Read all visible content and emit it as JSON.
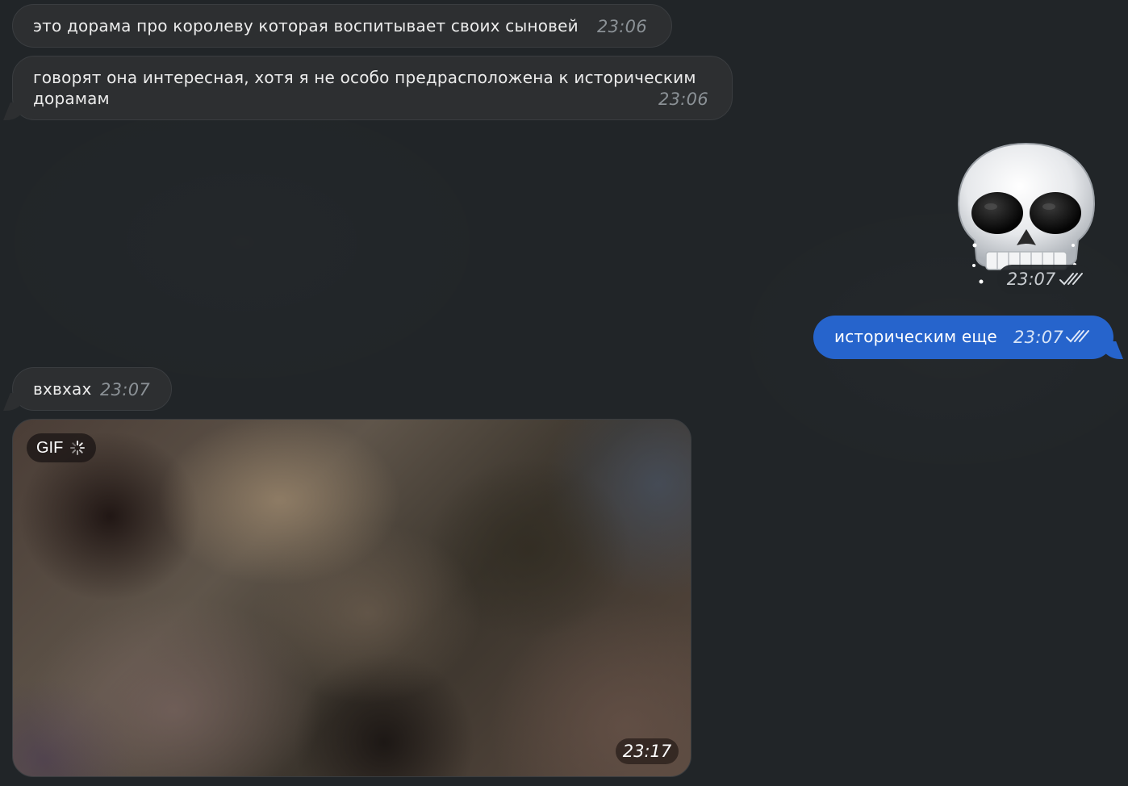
{
  "messages": [
    {
      "text": "это дорама про королеву которая воспитывает своих сыновей",
      "time": "23:06"
    },
    {
      "text": "говорят она интересная, хотя я не особо предрасположена к историческим дорамам",
      "time": "23:06"
    },
    {
      "sticker": "skull-emoji",
      "time": "23:07"
    },
    {
      "text": "историческим еще",
      "time": "23:07"
    },
    {
      "text": "вхвхах",
      "time": "23:07"
    },
    {
      "gif_label": "GIF",
      "time": "23:17"
    }
  ],
  "colors": {
    "background": "#212528",
    "incoming_bubble": "#2d2f31",
    "outgoing_bubble": "#2664cc"
  }
}
